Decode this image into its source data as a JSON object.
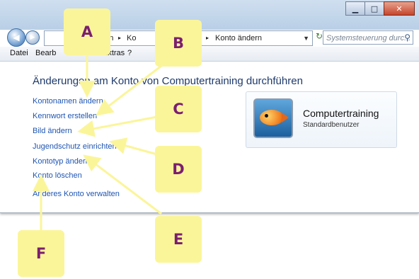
{
  "window": {
    "controls": {
      "minimize": "▁",
      "maximize": "□",
      "close": "✕"
    },
    "nav": {
      "back": "◀",
      "forward": "▶"
    },
    "address": {
      "seg1": "nten",
      "seg2": "Ko",
      "seg3": "Konto ändern",
      "sep": "▸"
    },
    "search_placeholder": "Systemsteuerung durc...",
    "refresh": "↻"
  },
  "menu": {
    "datei": "Datei",
    "bearb": "Bearb",
    "extras": "Extras",
    "hilfe": "?"
  },
  "page": {
    "heading": "Änderungen am Konto von Computertraining durchführen",
    "links": [
      "Kontonamen ändern",
      "Kennwort erstellen",
      "Bild ändern",
      "Jugendschutz einrichten",
      "Kontotyp ändern",
      "Konto löschen",
      "Anderes Konto verwalten"
    ]
  },
  "account": {
    "name": "Computertraining",
    "type": "Standardbenutzer"
  },
  "callouts": {
    "a": "A",
    "b": "B",
    "c": "C",
    "d": "D",
    "e": "E",
    "f": "F"
  },
  "colors": {
    "callout_bg": "#fbf59a",
    "callout_text": "#7a1f6e",
    "link": "#1f56b3",
    "heading": "#1e3a6b"
  }
}
